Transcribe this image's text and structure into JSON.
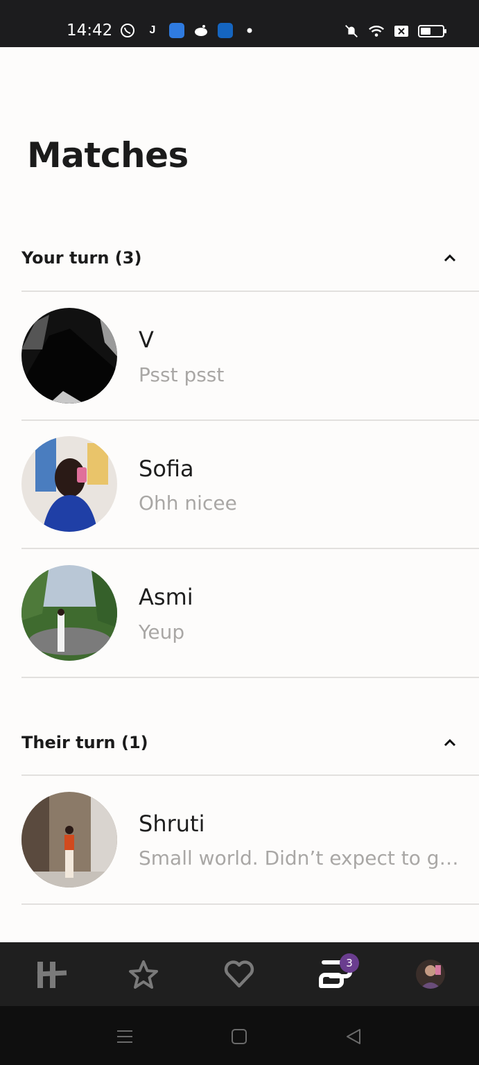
{
  "status_bar": {
    "time": "14:42",
    "icons_left": [
      "whatsapp-icon",
      "j-app-icon",
      "blue-app-icon",
      "reddit-icon",
      "shop-app-icon",
      "dot-icon"
    ],
    "icons_right": [
      "mute-vibrate-icon",
      "wifi-icon",
      "no-sim-icon",
      "battery-icon"
    ],
    "battery_level": 0.4
  },
  "page": {
    "title": "Matches"
  },
  "sections": [
    {
      "label": "Your turn (3)",
      "items": [
        {
          "name": "V",
          "message": "Psst psst",
          "avatar_colors": [
            "#0b0b0b",
            "#9a9a9a"
          ]
        },
        {
          "name": "Sofia",
          "message": "Ohh nicee",
          "avatar_colors": [
            "#1f3fa6",
            "#e9c46a"
          ]
        },
        {
          "name": "Asmi",
          "message": "Yeup",
          "avatar_colors": [
            "#3f6b2f",
            "#b9c7d6"
          ]
        }
      ]
    },
    {
      "label": "Their turn (1)",
      "items": [
        {
          "name": "Shruti",
          "message": "Small world. Didn’t expect to get …",
          "avatar_colors": [
            "#7a6a5a",
            "#d14a1e"
          ]
        }
      ]
    }
  ],
  "tabbar": {
    "tabs": [
      "hinge-logo-icon",
      "standouts-star-icon",
      "likes-heart-icon",
      "matches-chat-icon",
      "profile-avatar-icon"
    ],
    "active_tab": "matches-chat-icon",
    "badge_count": "3",
    "badge_color": "#6a3d8f"
  },
  "navbar": {
    "buttons": [
      "menu-icon",
      "home-icon",
      "back-icon"
    ]
  }
}
